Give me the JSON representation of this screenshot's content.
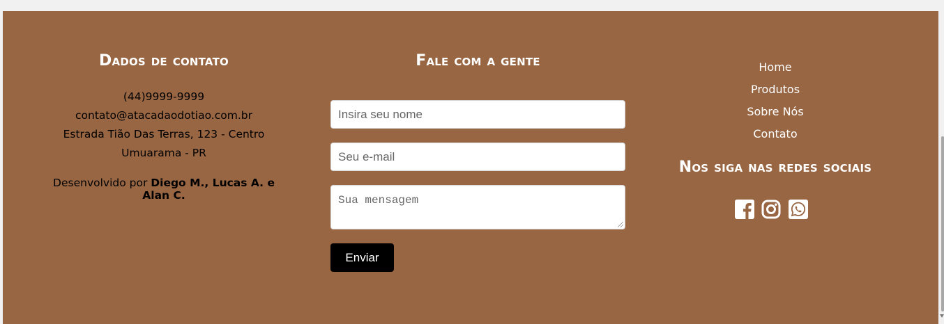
{
  "contact": {
    "heading": "Dados de contato",
    "phone": "(44)9999-9999",
    "email": "contato@atacadaodotiao.com.br",
    "address": "Estrada Tião Das Terras, 123 - Centro",
    "city": "Umuarama - PR",
    "developed_by_prefix": "Desenvolvido por",
    "developers": "Diego M., Lucas A. e Alan C."
  },
  "form": {
    "heading": "Fale com a gente",
    "name_placeholder": "Insira seu nome",
    "email_placeholder": "Seu e-mail",
    "message_placeholder": "Sua mensagem",
    "submit_label": "Enviar"
  },
  "nav": {
    "items": [
      {
        "label": "Home"
      },
      {
        "label": "Produtos"
      },
      {
        "label": "Sobre Nós"
      },
      {
        "label": "Contato"
      }
    ]
  },
  "social": {
    "heading": "Nos siga nas redes sociais",
    "icons": [
      "facebook-icon",
      "instagram-icon",
      "whatsapp-icon"
    ]
  },
  "colors": {
    "footer_background": "#986643",
    "button_background": "#000000",
    "text": "#ffffff"
  }
}
